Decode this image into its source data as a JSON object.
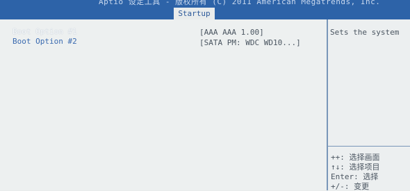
{
  "header": {
    "title": "Aptio 设定工具 - 版权所有 (C) 2011 American Megatrends, Inc."
  },
  "tabs": [
    {
      "label": "Startup",
      "selected": true
    }
  ],
  "boot_options": [
    {
      "label": "Boot Option #1",
      "value": "[AAA AAA 1.00]",
      "selected": true
    },
    {
      "label": "Boot Option #2",
      "value": "[SATA  PM: WDC WD10...]",
      "selected": false
    }
  ],
  "help": {
    "description": "Sets the system",
    "hotkeys": [
      "++: 选择画面",
      "↑↓: 选择项目",
      "Enter: 选择",
      "+/-: 变更"
    ]
  },
  "colors": {
    "header_bg": "#2d63a8",
    "panel_bg": "#edf0f0",
    "accent_text": "#3b6bb0",
    "divider": "#7896b8"
  }
}
